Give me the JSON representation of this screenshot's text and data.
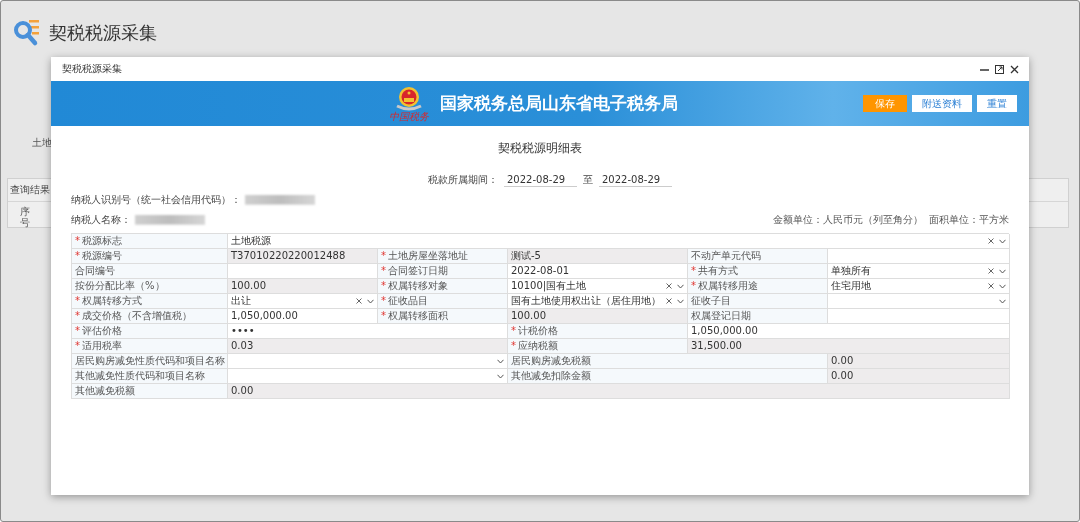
{
  "page": {
    "title": "契税税源采集",
    "fragment": "土地",
    "result_panel": {
      "title": "查询结果",
      "columns": [
        "序号"
      ]
    }
  },
  "modal": {
    "title": "契税税源采集",
    "banner": {
      "seal_text": "中国税务",
      "title": "国家税务总局山东省电子税务局",
      "buttons": [
        {
          "label": "保存",
          "kind": "primary"
        },
        {
          "label": "附送资料",
          "kind": "plain"
        },
        {
          "label": "重置",
          "kind": "plain"
        }
      ]
    },
    "form": {
      "title": "契税税源明细表",
      "period": {
        "label": "税款所属期间：",
        "from": "2022-08-29",
        "separator": "至",
        "to": "2022-08-29"
      },
      "taxpayer_id": {
        "label": "纳税人识别号（统一社会信用代码）：",
        "redacted": true
      },
      "taxpayer_name": {
        "label": "纳税人名称：",
        "redacted": true
      },
      "required_mark": "*",
      "units": [
        "金额单位：人民币元（列至角分）",
        "面积单位：平方米"
      ],
      "rows": [
        {
          "cells": [
            {
              "kind": "label",
              "text": "税源标志",
              "required": true
            },
            {
              "kind": "select",
              "value": "土地税源",
              "clearable": true
            }
          ]
        },
        {
          "cells": [
            {
              "kind": "label",
              "text": "税源编号",
              "required": true
            },
            {
              "kind": "input",
              "value": "T37010220220012488",
              "readonly": true
            },
            {
              "kind": "label",
              "text": "土地房屋坐落地址",
              "required": true
            },
            {
              "kind": "input",
              "value": "测试-5",
              "readonly": true
            },
            {
              "kind": "label",
              "text": "不动产单元代码",
              "required": false
            },
            {
              "kind": "input",
              "readonly": false
            }
          ]
        },
        {
          "cells": [
            {
              "kind": "label",
              "text": "合同编号",
              "required": false
            },
            {
              "kind": "input",
              "readonly": false
            },
            {
              "kind": "label",
              "text": "合同签订日期",
              "required": true
            },
            {
              "kind": "input",
              "value": "2022-08-01",
              "readonly": false
            },
            {
              "kind": "label",
              "text": "共有方式",
              "required": true
            },
            {
              "kind": "select",
              "value": "单独所有",
              "clearable": true
            }
          ]
        },
        {
          "cells": [
            {
              "kind": "label",
              "text": "按份分配比率（%）",
              "required": false
            },
            {
              "kind": "input",
              "value": "100.00",
              "readonly": true
            },
            {
              "kind": "label",
              "text": "权属转移对象",
              "required": true
            },
            {
              "kind": "select",
              "value": "10100|国有土地",
              "clearable": true
            },
            {
              "kind": "label",
              "text": "权属转移用途",
              "required": true
            },
            {
              "kind": "select",
              "value": "住宅用地",
              "clearable": true
            }
          ]
        },
        {
          "cells": [
            {
              "kind": "label",
              "text": "权属转移方式",
              "required": true
            },
            {
              "kind": "select",
              "value": "出让",
              "clearable": true
            },
            {
              "kind": "label",
              "text": "征收品目",
              "required": true
            },
            {
              "kind": "select",
              "value": "国有土地使用权出让（居住用地）",
              "clearable": true
            },
            {
              "kind": "label",
              "text": "征收子目",
              "required": false
            },
            {
              "kind": "select",
              "clearable": false
            }
          ]
        },
        {
          "cells": [
            {
              "kind": "label",
              "text": "成交价格（不含增值税）",
              "required": true
            },
            {
              "kind": "input",
              "value": "1,050,000.00",
              "readonly": false
            },
            {
              "kind": "label",
              "text": "权属转移面积",
              "required": true
            },
            {
              "kind": "input",
              "value": "100.00",
              "readonly": true
            },
            {
              "kind": "label",
              "text": "权属登记日期",
              "required": false
            },
            {
              "kind": "input",
              "readonly": false
            }
          ]
        },
        {
          "cells": [
            {
              "kind": "label",
              "text": "评估价格",
              "required": true
            },
            {
              "kind": "input",
              "value": "••••",
              "readonly": false
            },
            {
              "kind": "label",
              "text": "计税价格",
              "required": true
            },
            {
              "kind": "input",
              "value": "1,050,000.00",
              "readonly": false
            }
          ]
        },
        {
          "cells": [
            {
              "kind": "label",
              "text": "适用税率",
              "required": true
            },
            {
              "kind": "input",
              "value": "0.03",
              "readonly": true
            },
            {
              "kind": "label",
              "text": "应纳税额",
              "required": true
            },
            {
              "kind": "input",
              "value": "31,500.00",
              "readonly": true
            }
          ]
        },
        {
          "cells": [
            {
              "kind": "label",
              "text": "居民购房减免性质代码和项目名称",
              "required": false
            },
            {
              "kind": "select",
              "clearable": false
            },
            {
              "kind": "label",
              "text": "居民购房减免税额",
              "required": false
            },
            {
              "kind": "input",
              "value": "0.00",
              "readonly": true
            }
          ]
        },
        {
          "cells": [
            {
              "kind": "label",
              "text": "其他减免性质代码和项目名称",
              "required": false
            },
            {
              "kind": "select",
              "clearable": false
            },
            {
              "kind": "label",
              "text": "其他减免扣除金额",
              "required": false
            },
            {
              "kind": "input",
              "value": "0.00",
              "readonly": true
            }
          ]
        },
        {
          "cells": [
            {
              "kind": "label",
              "text": "其他减免税额",
              "required": false
            },
            {
              "kind": "input",
              "value": "0.00",
              "readonly": true
            }
          ]
        }
      ]
    }
  }
}
